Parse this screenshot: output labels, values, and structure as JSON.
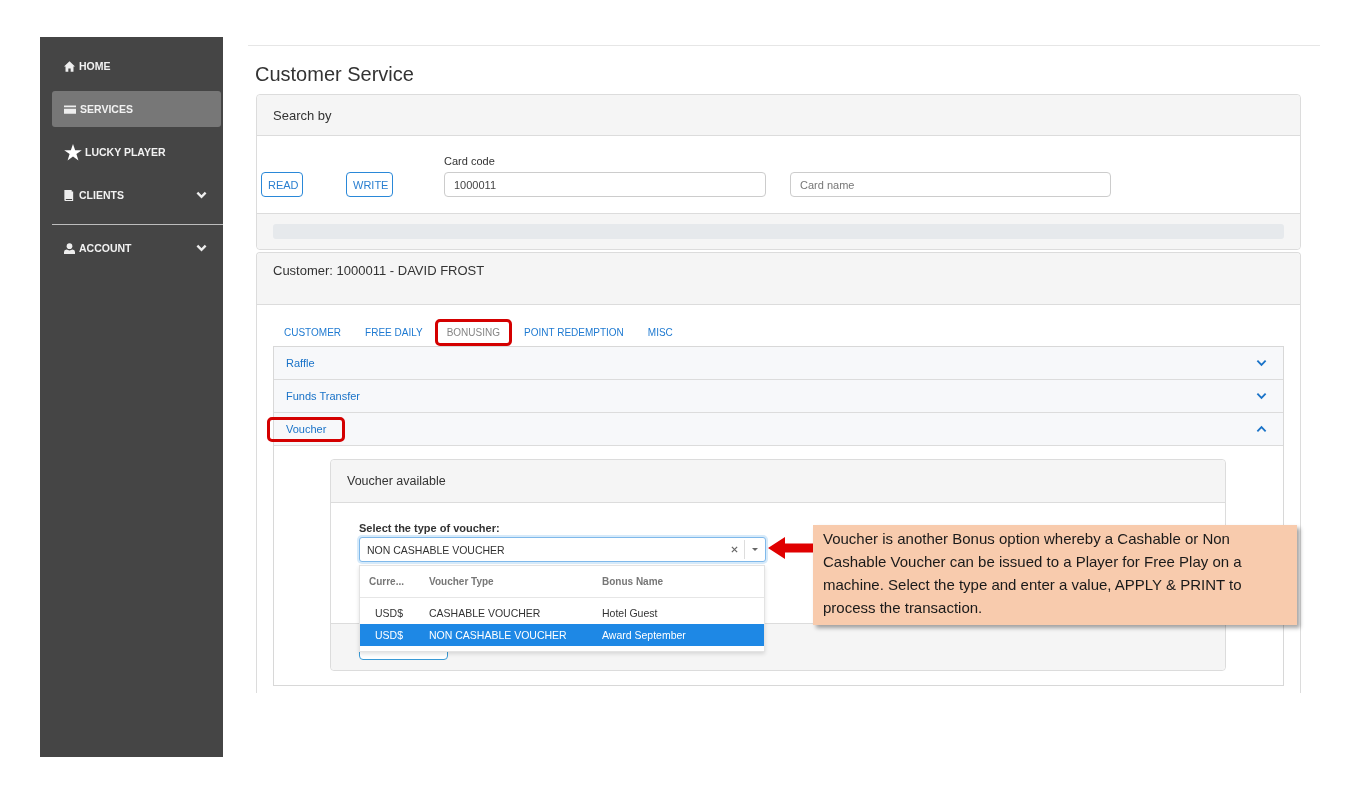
{
  "sidebar": {
    "sections": [
      {
        "items": [
          {
            "label": "HOME",
            "selected": false
          },
          {
            "label": "SERVICES",
            "selected": true
          },
          {
            "label": "LUCKY PLAYER",
            "selected": false
          },
          {
            "label": "CLIENTS",
            "selected": false,
            "expanded": false
          }
        ]
      },
      {
        "items": [
          {
            "label": "ACCOUNT",
            "selected": false,
            "expanded": false
          }
        ]
      }
    ]
  },
  "page": {
    "title": "Customer Service"
  },
  "search": {
    "title": "Search by",
    "buttons": [
      "READ",
      "WRITE"
    ],
    "card_code": {
      "label": "Card code",
      "value": "1000011"
    },
    "card_name": {
      "placeholder": "Card name"
    },
    "progress": {
      "level": 0
    }
  },
  "customer": {
    "title": "Customer: 1000011 - DAVID FROST",
    "tabs": [
      {
        "label": "CUSTOMER",
        "selected": false,
        "highlighted": false
      },
      {
        "label": "FREE DAILY",
        "selected": false,
        "highlighted": false
      },
      {
        "label": "BONUSING",
        "selected": true,
        "highlighted": true
      },
      {
        "label": "POINT REDEMPTION",
        "selected": false,
        "highlighted": false
      },
      {
        "label": "MISC",
        "selected": false,
        "highlighted": false
      }
    ],
    "sections": [
      {
        "title": "Raffle",
        "expanded": false,
        "highlighted": false
      },
      {
        "title": "Funds Transfer",
        "expanded": false,
        "highlighted": false
      },
      {
        "title": "Voucher",
        "expanded": true,
        "highlighted": true,
        "panel": {
          "title": "Voucher available",
          "select": {
            "label": "Select the type of voucher:",
            "value": "NON CASHABLE VOUCHER",
            "open": true,
            "columns": [
              "Curre...",
              "Voucher Type",
              "Bonus Name"
            ],
            "options": [
              {
                "cells": [
                  "USD$",
                  "CASHABLE VOUCHER",
                  "Hotel Guest"
                ],
                "selected": false
              },
              {
                "cells": [
                  "USD$",
                  "NON CASHABLE VOUCHER",
                  "Award September"
                ],
                "selected": true
              }
            ]
          }
        }
      }
    ]
  },
  "callout": {
    "text": "Voucher is another Bonus option whereby a Cashable or Non Cashable Voucher can be issued to a Player for Free Play on a machine. Select the type and enter a value, APPLY & PRINT to process the transaction."
  }
}
